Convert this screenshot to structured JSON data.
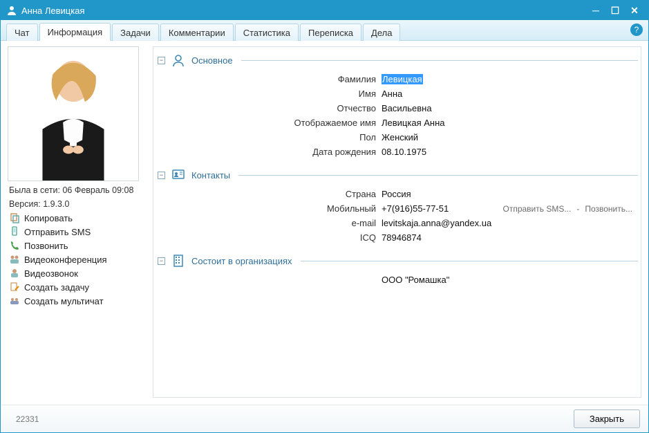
{
  "window": {
    "title": "Анна Левицкая"
  },
  "tabs": [
    {
      "label": "Чат"
    },
    {
      "label": "Информация",
      "active": true
    },
    {
      "label": "Задачи"
    },
    {
      "label": "Комментарии"
    },
    {
      "label": "Статистика"
    },
    {
      "label": "Переписка"
    },
    {
      "label": "Дела"
    }
  ],
  "meta": {
    "last_seen": "Была в сети: 06 Февраль 09:08",
    "version": "Версия: 1.9.3.0"
  },
  "actions": {
    "copy": "Копировать",
    "send_sms": "Отправить SMS",
    "call": "Позвонить",
    "video_conf": "Видеоконференция",
    "video_call": "Видеозвонок",
    "create_task": "Создать задачу",
    "create_multichat": "Создать мультичат"
  },
  "sections": {
    "main": {
      "title": "Основное",
      "fields": {
        "surname_label": "Фамилия",
        "surname_value": "Левицкая",
        "name_label": "Имя",
        "name_value": "Анна",
        "patronymic_label": "Отчество",
        "patronymic_value": "Васильевна",
        "display_label": "Отображаемое имя",
        "display_value": "Левицкая Анна",
        "gender_label": "Пол",
        "gender_value": "Женский",
        "dob_label": "Дата рождения",
        "dob_value": "08.10.1975"
      }
    },
    "contacts": {
      "title": "Контакты",
      "fields": {
        "country_label": "Страна",
        "country_value": "Россия",
        "mobile_label": "Мобильный",
        "mobile_value": "+7(916)55-77-51",
        "email_label": "e-mail",
        "email_value": "levitskaja.anna@yandex.ua",
        "icq_label": "ICQ",
        "icq_value": "78946874"
      },
      "row_actions": {
        "send_sms": "Отправить SMS...",
        "sep": "-",
        "call": "Позвонить..."
      }
    },
    "orgs": {
      "title": "Состоит в организациях",
      "value": "ООО \"Ромашка\""
    }
  },
  "footer": {
    "id": "22331",
    "close": "Закрыть"
  }
}
